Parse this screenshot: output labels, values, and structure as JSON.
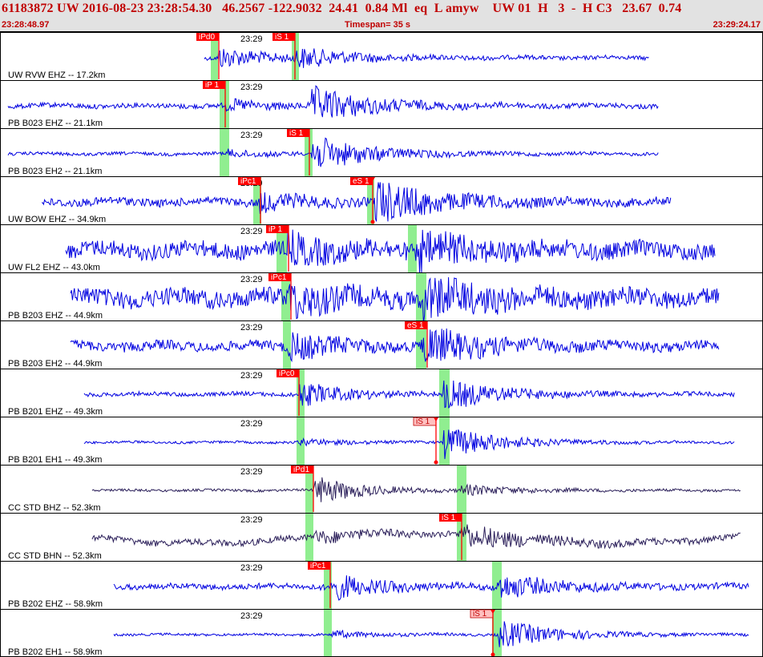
{
  "header": {
    "event_line": "61183872 UW 2016-08-23 23:28:54.30   46.2567 -122.9032  24.41  0.84 Ml  eq  L amyw    UW 01  H   3  -  H C3   23.67  0.74",
    "start_time": "23:28:48.97",
    "timespan": "Timespan=  35 s",
    "end_time": "23:29:24.17"
  },
  "minute_label": "23:29",
  "colors": {
    "trace": "#0000e0",
    "trace_dark": "#2b1f5a",
    "pick_red": "#ff0000",
    "pick_pink": "#ffc0c0",
    "band": "#90ee90"
  },
  "channels": [
    {
      "label": "UW RVW EHZ -- 17.2km",
      "color": "trace",
      "picks": [
        {
          "text": "iPd0",
          "fill": "red"
        },
        {
          "text": "iS 1",
          "fill": "red"
        }
      ]
    },
    {
      "label": "PB B023 EHZ -- 21.1km",
      "color": "trace",
      "picks": [
        {
          "text": "iP 1",
          "fill": "red"
        }
      ]
    },
    {
      "label": "PB B023 EH2 -- 21.1km",
      "color": "trace",
      "picks": [
        {
          "text": "iS 1",
          "fill": "red"
        }
      ]
    },
    {
      "label": "UW BOW EHZ -- 34.9km",
      "color": "trace",
      "picks": [
        {
          "text": "iPc1",
          "fill": "red"
        },
        {
          "text": "eS 1",
          "fill": "red"
        }
      ]
    },
    {
      "label": "UW FL2 EHZ -- 43.0km",
      "color": "trace",
      "picks": [
        {
          "text": "iP 1",
          "fill": "red"
        }
      ]
    },
    {
      "label": "PB B203 EHZ -- 44.9km",
      "color": "trace",
      "picks": [
        {
          "text": "iPc1",
          "fill": "red"
        }
      ]
    },
    {
      "label": "PB B203 EH2 -- 44.9km",
      "color": "trace",
      "picks": [
        {
          "text": "eS 1",
          "fill": "red"
        }
      ]
    },
    {
      "label": "PB B201 EHZ -- 49.3km",
      "color": "trace",
      "picks": [
        {
          "text": "iPc0",
          "fill": "red"
        }
      ]
    },
    {
      "label": "PB B201 EH1 -- 49.3km",
      "color": "trace",
      "picks": [
        {
          "text": "iS 1",
          "fill": "pink"
        }
      ]
    },
    {
      "label": "CC STD BHZ -- 52.3km",
      "color": "trace_dark",
      "picks": [
        {
          "text": "iPd1",
          "fill": "red"
        }
      ]
    },
    {
      "label": "CC STD BHN -- 52.3km",
      "color": "trace_dark",
      "picks": [
        {
          "text": "iS 1",
          "fill": "red"
        }
      ]
    },
    {
      "label": "PB B202 EHZ -- 58.9km",
      "color": "trace",
      "picks": [
        {
          "text": "iPc1",
          "fill": "red"
        }
      ]
    },
    {
      "label": "PB B202 EH1 -- 58.9km",
      "color": "trace",
      "picks": [
        {
          "text": "iS 1",
          "fill": "pink"
        }
      ]
    }
  ]
}
